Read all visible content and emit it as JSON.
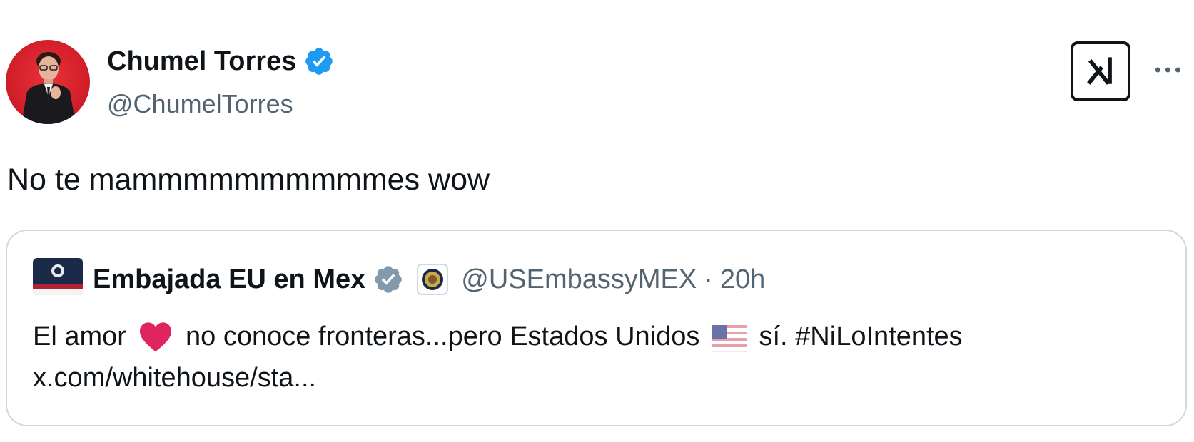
{
  "tweet": {
    "author": {
      "display_name": "Chumel Torres",
      "handle": "@ChumelTorres",
      "verified": true
    },
    "text": "No te mammmmmmmmmmes wow"
  },
  "actions": {
    "grok_icon": "grok-icon",
    "more_icon": "more-dots-icon"
  },
  "quote": {
    "author": {
      "display_name": "Embajada EU en Mex",
      "handle": "@USEmbassyMEX",
      "separator": "·",
      "time": "20h",
      "verified": true
    },
    "text_part1": "El amor",
    "text_part2": "no conoce fronteras...pero Estados Unidos",
    "text_part3": "sí.",
    "hashtag": "#NiLoIntentes",
    "link": "x.com/whitehouse/sta..."
  },
  "colors": {
    "verified_blue": "#1d9bf0",
    "verified_gray": "#829aab",
    "secondary_text": "#536471",
    "border": "#cfd9de",
    "heart": "#e0245e"
  }
}
